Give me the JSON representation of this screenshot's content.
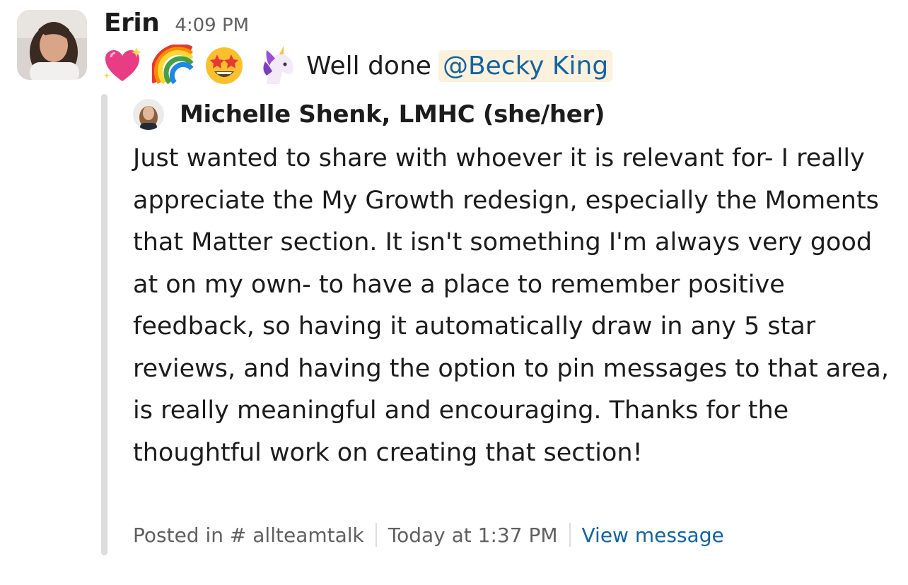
{
  "message": {
    "author": "Erin",
    "time": "4:09 PM",
    "emojis": [
      "sparkling-heart",
      "rainbow",
      "star-struck",
      "unicorn"
    ],
    "text": "Well done",
    "mention": "@Becky King"
  },
  "quote": {
    "author": "Michelle Shenk, LMHC (she/her)",
    "body": "Just wanted to share with whoever it is relevant for- I really appreciate the My Growth redesign, especially the Moments that Matter section. It isn't something I'm always very good at on my own- to have a place to remember positive feedback, so having it automatically draw in any 5 star reviews, and having the option to pin messages to that area, is really meaningful and encouraging. Thanks for the thoughtful work on creating that section!",
    "posted_in": "Posted in # allteamtalk",
    "posted_at": "Today at 1:37 PM",
    "view_link": "View message"
  },
  "colors": {
    "link": "#1264a3",
    "mention_bg": "#fcf1dc",
    "quote_bar": "#dddddd",
    "muted": "#616061"
  }
}
